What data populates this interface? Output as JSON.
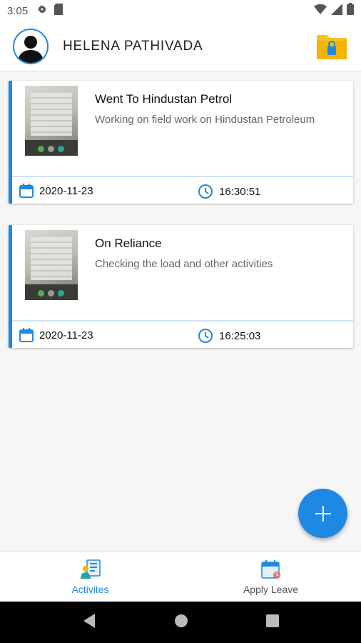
{
  "status_bar": {
    "time": "3:05"
  },
  "header": {
    "user_name": "HELENA PATHIVADA"
  },
  "activities": [
    {
      "title": "Went To Hindustan Petrol",
      "description": "Working on field work on Hindustan Petroleum",
      "date": "2020-11-23",
      "time": "16:30:51"
    },
    {
      "title": "On Reliance",
      "description": "Checking the load and other activities",
      "date": "2020-11-23",
      "time": "16:25:03"
    }
  ],
  "bottom_nav": {
    "activities_label": "Activites",
    "leave_label": "Apply Leave",
    "active": "activities"
  },
  "colors": {
    "accent": "#1e88e5",
    "folder": "#f8c21b"
  },
  "icons": [
    "settings-icon",
    "sd-card-icon",
    "wifi-icon",
    "signal-icon",
    "battery-icon",
    "folder-lock-icon",
    "calendar-icon",
    "clock-icon",
    "plus-icon",
    "activities-icon",
    "apply-leave-icon",
    "back-icon",
    "home-icon",
    "recents-icon"
  ]
}
